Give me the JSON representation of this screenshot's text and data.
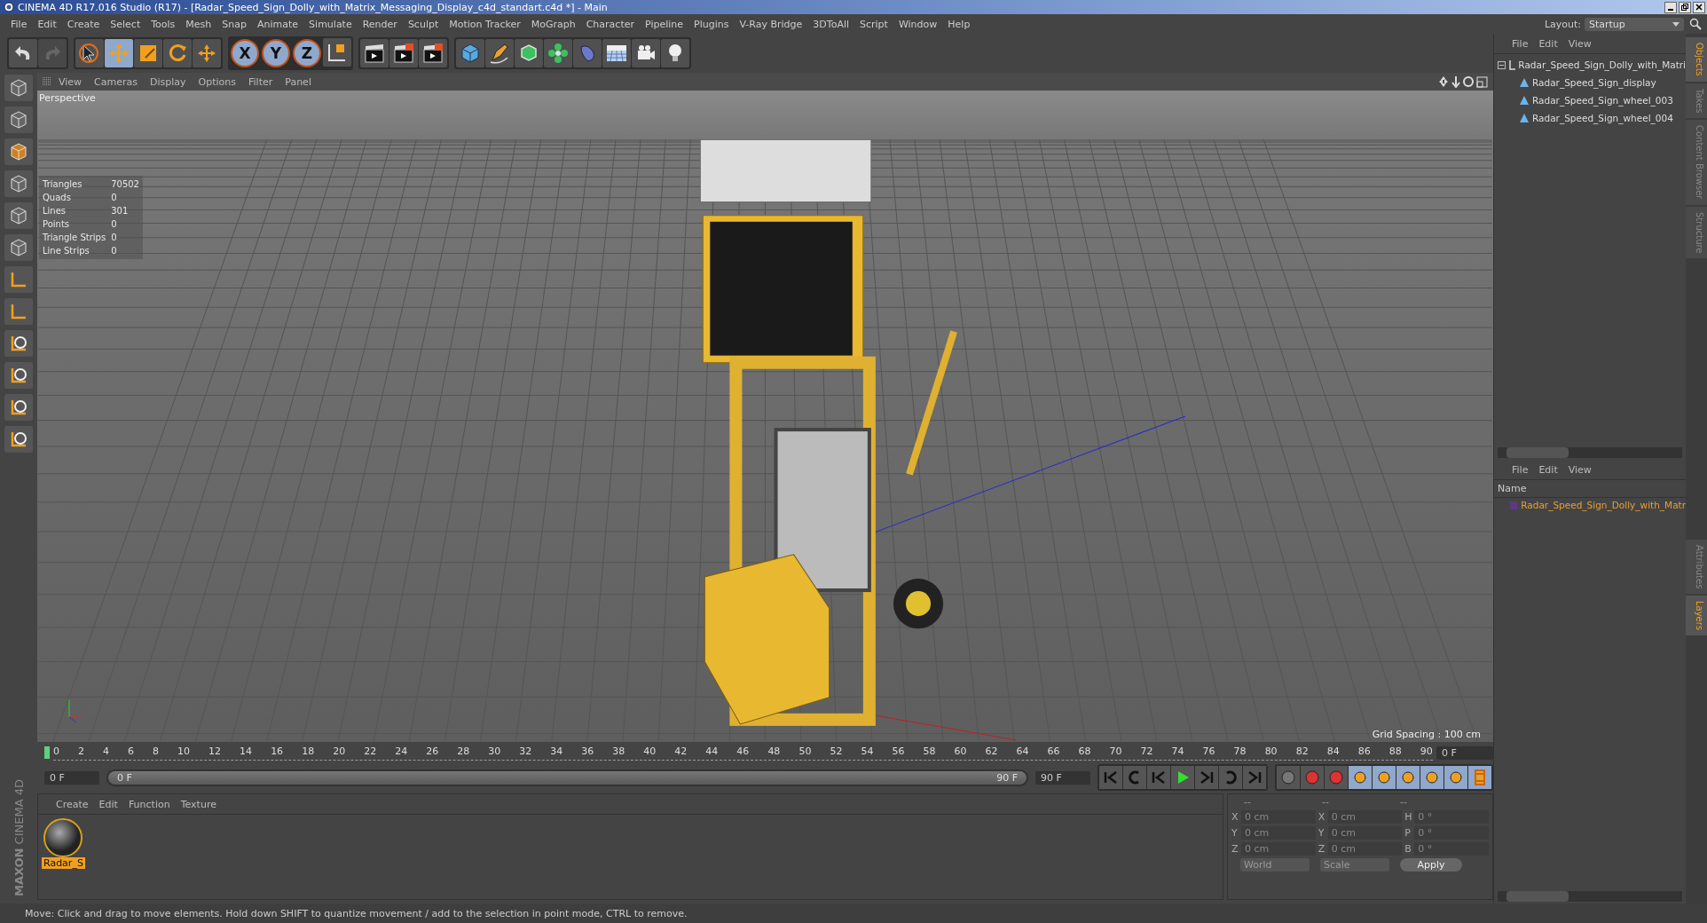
{
  "window": {
    "title": "CINEMA 4D R17.016 Studio (R17) - [Radar_Speed_Sign_Dolly_with_Matrix_Messaging_Display_c4d_standart.c4d *] - Main"
  },
  "menu": [
    "File",
    "Edit",
    "Create",
    "Select",
    "Tools",
    "Mesh",
    "Snap",
    "Animate",
    "Simulate",
    "Render",
    "Sculpt",
    "Motion Tracker",
    "MoGraph",
    "Character",
    "Pipeline",
    "Plugins",
    "V-Ray Bridge",
    "3DToAll",
    "Script",
    "Window",
    "Help"
  ],
  "layout": {
    "label": "Layout:",
    "value": "Startup"
  },
  "toolbar": {
    "tools": [
      {
        "selected": false
      },
      {
        "selected": true
      },
      {
        "selected": false
      },
      {
        "selected": false
      },
      {
        "selected": false
      }
    ],
    "axes": [
      {
        "label": "X",
        "selected": true
      },
      {
        "label": "Y",
        "selected": true
      },
      {
        "label": "Z",
        "selected": true
      }
    ]
  },
  "viewport": {
    "menu": [
      "View",
      "Cameras",
      "Display",
      "Options",
      "Filter",
      "Panel"
    ],
    "camera": "Perspective",
    "grid_spacing": "Grid Spacing : 100 cm",
    "stats": [
      {
        "label": "Triangles",
        "value": "70502"
      },
      {
        "label": "Quads",
        "value": "0"
      },
      {
        "label": "Lines",
        "value": "301"
      },
      {
        "label": "Points",
        "value": "0"
      },
      {
        "label": "Triangle Strips",
        "value": "0"
      },
      {
        "label": "Line Strips",
        "value": "0"
      }
    ]
  },
  "timeline": {
    "ticks": [
      "0",
      "2",
      "4",
      "6",
      "8",
      "10",
      "12",
      "14",
      "16",
      "18",
      "20",
      "22",
      "24",
      "26",
      "28",
      "30",
      "32",
      "34",
      "36",
      "38",
      "40",
      "42",
      "44",
      "46",
      "48",
      "50",
      "52",
      "54",
      "56",
      "58",
      "60",
      "62",
      "64",
      "66",
      "68",
      "70",
      "72",
      "74",
      "76",
      "78",
      "80",
      "82",
      "84",
      "86",
      "88",
      "90"
    ],
    "current_frame": "0 F",
    "start_field": "0 F",
    "range_start": "0 F",
    "range_end": "90 F",
    "range": {
      "level": 1
    },
    "end_field": "90 F"
  },
  "materials": {
    "menu": [
      "Create",
      "Edit",
      "Function",
      "Texture"
    ],
    "items": [
      {
        "name": "Radar_S",
        "selected": true
      }
    ]
  },
  "brand": {
    "line1": "MAXON",
    "line2": "CINEMA 4D"
  },
  "coordinates": {
    "headers": [
      "--",
      "--",
      "--"
    ],
    "rows": [
      {
        "a": "X",
        "av": "0 cm",
        "b": "X",
        "bv": "0 cm",
        "c": "H",
        "cv": "0 °"
      },
      {
        "a": "Y",
        "av": "0 cm",
        "b": "Y",
        "bv": "0 cm",
        "c": "P",
        "cv": "0 °"
      },
      {
        "a": "Z",
        "av": "0 cm",
        "b": "Z",
        "bv": "0 cm",
        "c": "B",
        "cv": "0 °"
      }
    ],
    "mode": "World",
    "transform": "Scale",
    "apply": "Apply"
  },
  "objects": {
    "menu": [
      "File",
      "Edit",
      "View"
    ],
    "tree": [
      {
        "name": "Radar_Speed_Sign_Dolly_with_Matri",
        "expanded": true,
        "children": [
          {
            "name": "Radar_Speed_Sign_display"
          },
          {
            "name": "Radar_Speed_Sign_wheel_003"
          },
          {
            "name": "Radar_Speed_Sign_wheel_004"
          }
        ]
      }
    ]
  },
  "layers": {
    "menu": [
      "File",
      "Edit",
      "View"
    ],
    "header": "Name",
    "items": [
      {
        "name": "Radar_Speed_Sign_Dolly_with_Matr",
        "color": "#5b3a82"
      }
    ]
  },
  "side_tabs_top": [
    {
      "label": "Objects",
      "selected": true
    },
    {
      "label": "Takes",
      "selected": false
    },
    {
      "label": "Content Browser",
      "selected": false
    },
    {
      "label": "Structure",
      "selected": false
    }
  ],
  "side_tabs_bottom": [
    {
      "label": "Attributes",
      "selected": false
    },
    {
      "label": "Layers",
      "selected": true
    }
  ],
  "status_bar": "Move: Click and drag to move elements. Hold down SHIFT to quantize movement / add to the selection in point mode, CTRL to remove."
}
